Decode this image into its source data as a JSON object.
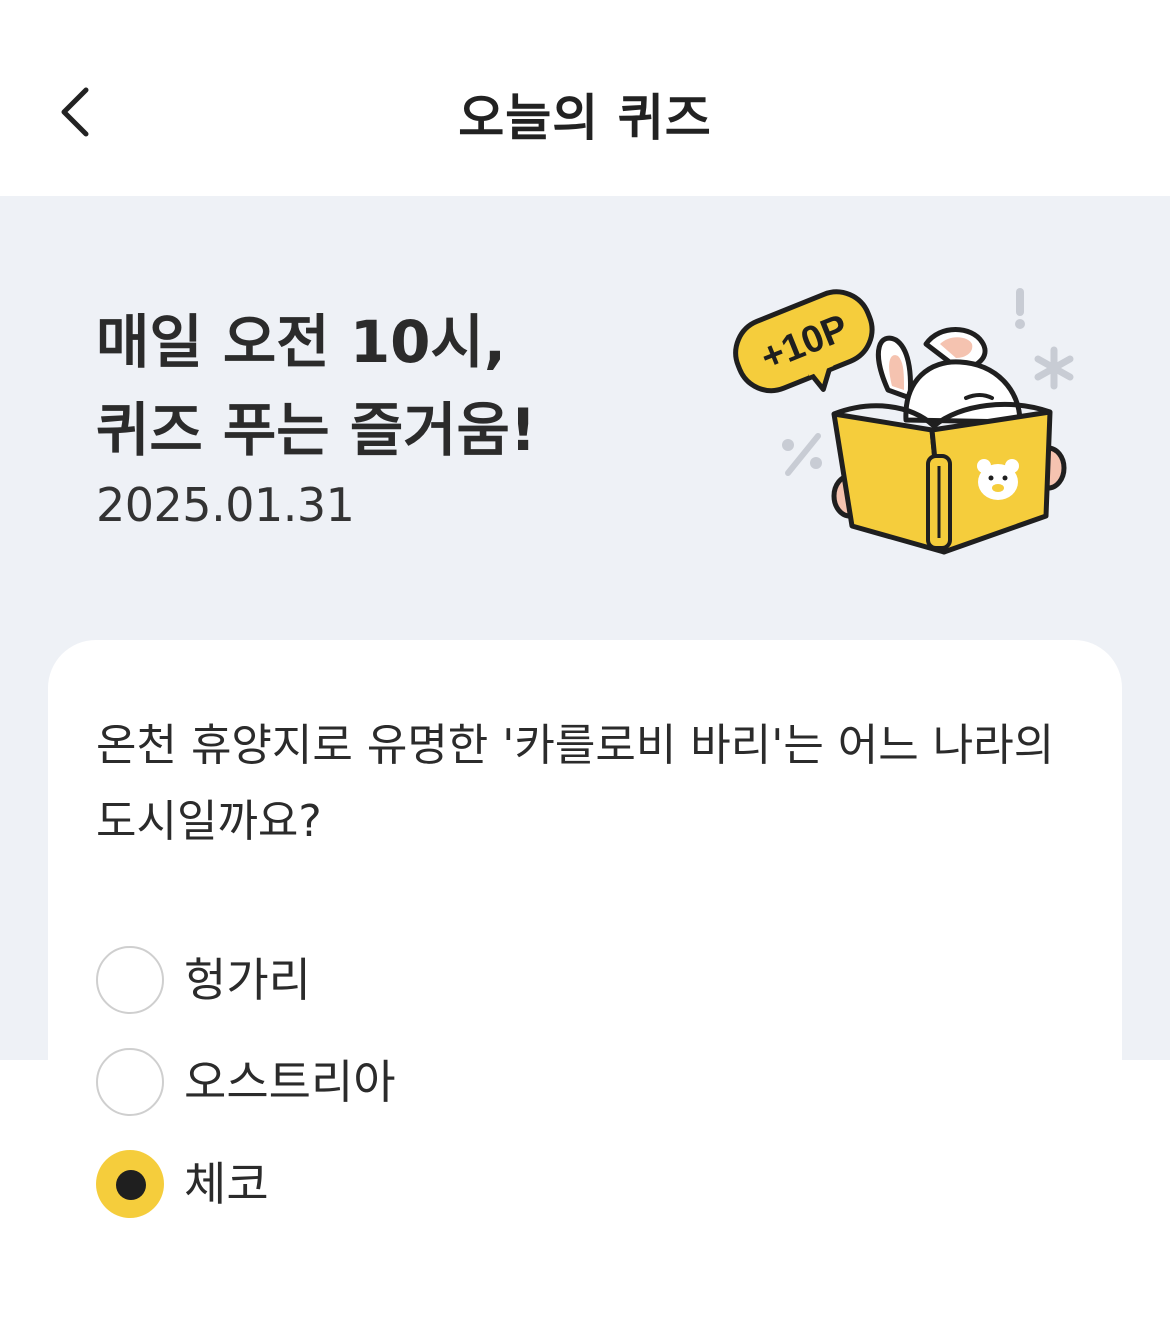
{
  "header": {
    "title": "오늘의 퀴즈",
    "back_icon": "chevron-left-icon"
  },
  "hero": {
    "title_line1": "매일 오전 10시,",
    "title_line2": "퀴즈 푸는 즐거움!",
    "date": "2025.01.31",
    "badge": "+10P",
    "colors": {
      "background": "#eef1f6",
      "accent": "#f5cd3c"
    }
  },
  "quiz": {
    "question_line1": "온천 휴양지로 유명한 '카를로비 바리'는 어느 나라의",
    "question_line2": "도시일까요?",
    "options": [
      {
        "label": "헝가리",
        "selected": false
      },
      {
        "label": "오스트리아",
        "selected": false
      },
      {
        "label": "체코",
        "selected": true
      }
    ]
  }
}
